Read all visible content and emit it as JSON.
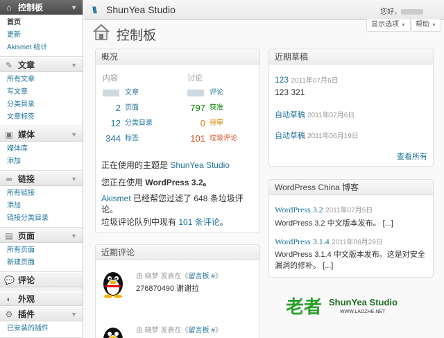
{
  "header": {
    "site_name": "ShunYea Studio",
    "howdy": "您好，",
    "screen_options": "显示选项",
    "help": "帮助"
  },
  "sidebar": {
    "dashboard": {
      "label": "控制板",
      "sub": [
        "首页",
        "更新",
        "Akismet 统计"
      ]
    },
    "posts": {
      "label": "文章",
      "sub": [
        "所有文章",
        "写文章",
        "分类目录",
        "文章标签"
      ]
    },
    "media": {
      "label": "媒体",
      "sub": [
        "媒体库",
        "添加"
      ]
    },
    "links": {
      "label": "链接",
      "sub": [
        "所有链接",
        "添加",
        "链接分类目录"
      ]
    },
    "pages": {
      "label": "页面",
      "sub": [
        "所有页面",
        "新建页面"
      ]
    },
    "comments": {
      "label": "评论"
    },
    "appearance": {
      "label": "外观"
    },
    "plugins": {
      "label": "插件",
      "sub": [
        "已安装的插件"
      ]
    }
  },
  "page_title": "控制板",
  "right_now": {
    "title": "概况",
    "content_header": "内容",
    "discussion_header": "讨论",
    "rows": [
      {
        "c_num": "",
        "c_label": "文章",
        "d_num": "",
        "d_label": "评论"
      },
      {
        "c_num": "2",
        "c_label": "页面",
        "d_num": "797",
        "d_label": "获准"
      },
      {
        "c_num": "12",
        "c_label": "分类目录",
        "d_num": "0",
        "d_label": "待审"
      },
      {
        "c_num": "344",
        "c_label": "标签",
        "d_num": "101",
        "d_label": "垃圾评论"
      }
    ],
    "theme_prefix": "正在使用的主题是 ",
    "theme_name": "ShunYea Studio",
    "version_prefix": "您正在使用 ",
    "version": "WordPress 3.2。",
    "akismet_link": "Akismet",
    "akismet_text": " 已经帮您过滤了 648 条垃圾评论。",
    "spam_queue_prefix": "垃圾评论队列中现有 ",
    "spam_queue_link": "101 条评论",
    "spam_queue_suffix": "。"
  },
  "recent_comments": {
    "title": "近期评论",
    "items": [
      {
        "meta_prefix": "由 晓梦 发表在《",
        "post": "留言板 #",
        "meta_suffix": "》",
        "text": "276870490 谢谢拉"
      },
      {
        "meta_prefix": "由 晓梦 发表在《",
        "post": "留言板 #",
        "meta_suffix": "》",
        "text": ""
      }
    ]
  },
  "recent_drafts": {
    "title": "近期草稿",
    "items": [
      {
        "title": "123",
        "date": "2011年07月6日",
        "excerpt": "123 321"
      },
      {
        "title": "自动草稿",
        "date": "2011年07月6日",
        "excerpt": ""
      },
      {
        "title": "自动草稿",
        "date": "2011年06月19日",
        "excerpt": ""
      }
    ],
    "view_all": "查看所有"
  },
  "blog": {
    "title": "WordPress China 博客",
    "items": [
      {
        "title": "WordPress 3.2",
        "date": "2011年07月5日",
        "text": "WordPress 3.2 中文版本发布。 [...]"
      },
      {
        "title": "WordPress 3.1.4",
        "date": "2011年06月29日",
        "text": "WordPress 3.1.4 中文版本发布。这是对安全漏洞的修补。 [...]"
      }
    ]
  },
  "watermark": {
    "logo": "老者",
    "studio": "ShunYea Studio",
    "url": "WWW.LAOZHE.NET"
  },
  "colors": {
    "link": "#21759b",
    "approved": "#008000",
    "pending": "#d98500",
    "spam": "#d54e21"
  }
}
